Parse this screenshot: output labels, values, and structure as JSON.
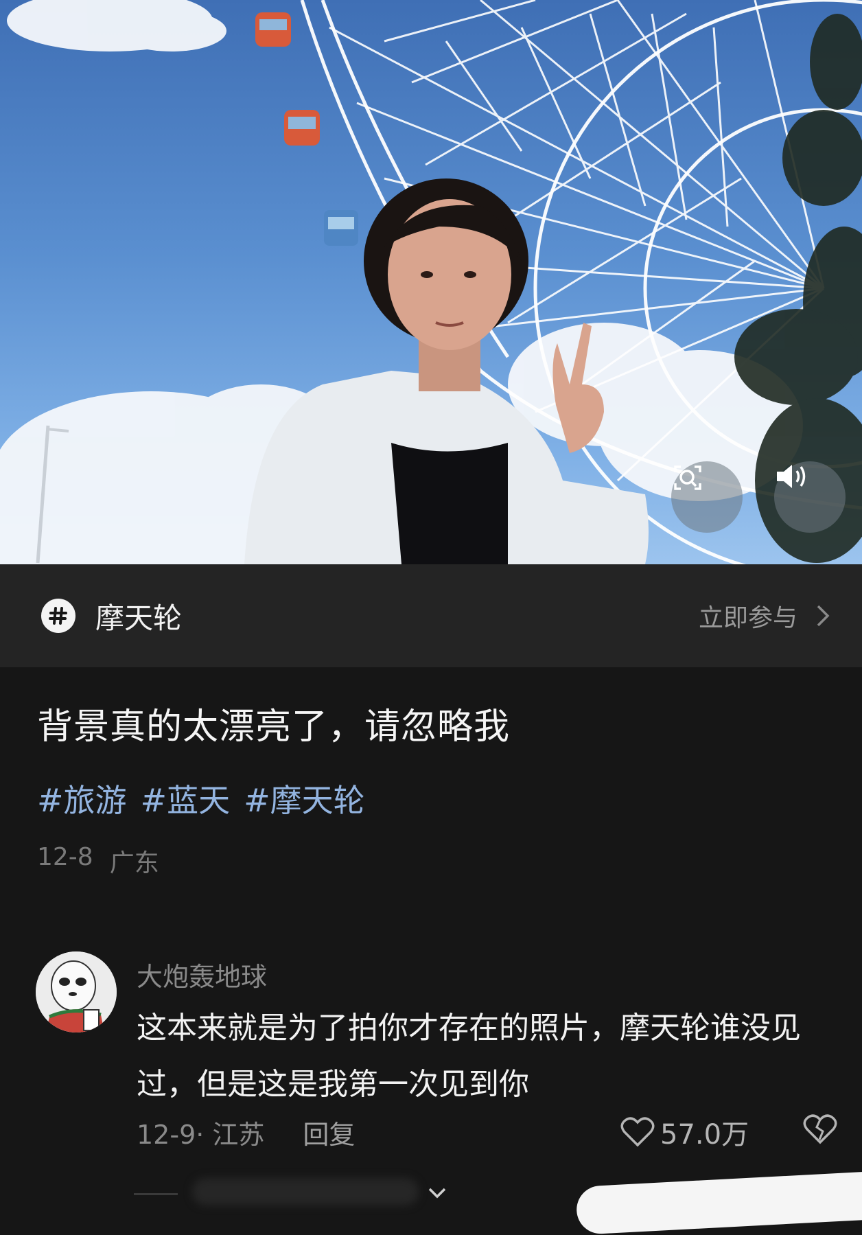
{
  "topic": {
    "name": "摩天轮",
    "join_label": "立即参与"
  },
  "post": {
    "caption": "背景真的太漂亮了，请忽略我",
    "tags": [
      "#旅游",
      "#蓝天",
      "#摩天轮"
    ],
    "date": "12-8",
    "location": "广东"
  },
  "comment": {
    "username": "大炮轰地球",
    "text": "这本来就是为了拍你才存在的照片，摩天轮谁没见过，但是这是我第一次见到你",
    "meta": "12-9· 江苏",
    "reply_label": "回复",
    "like_count": "57.0万"
  },
  "icons": {
    "topic": "hashtag-icon",
    "join": "chevron-right-icon",
    "zoom": "image-search-icon",
    "sound": "speaker-icon",
    "like": "heart-icon",
    "dislike": "broken-heart-icon",
    "expand": "chevron-down-icon"
  },
  "colors": {
    "tag": "#93b4e0",
    "background": "#161616",
    "topic_bar": "#242424"
  }
}
